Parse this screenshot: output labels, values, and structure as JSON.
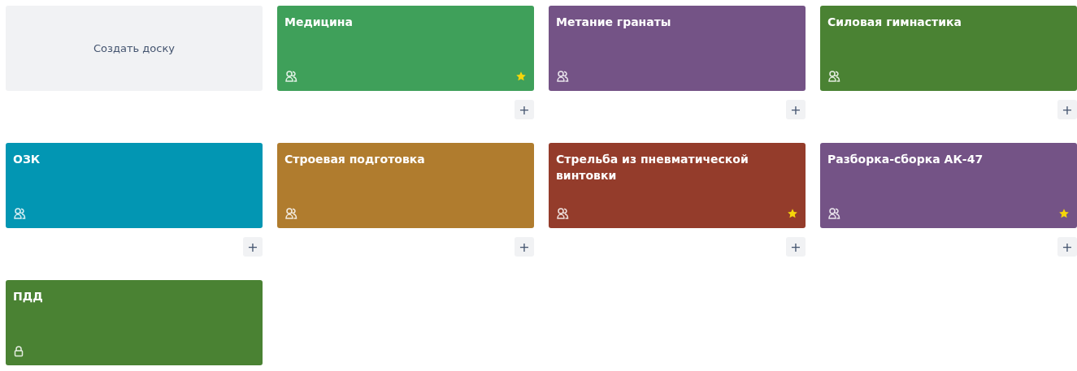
{
  "create_board": {
    "label": "Создать доску"
  },
  "boards": [
    {
      "title": "Медицина",
      "color": "#3fa05a",
      "kind": "team",
      "starred": true,
      "add": "+"
    },
    {
      "title": "Метание гранаты",
      "color": "#745386",
      "kind": "team",
      "starred": false,
      "add": "+"
    },
    {
      "title": "Силовая гимнастика",
      "color": "#4a8233",
      "kind": "team",
      "starred": false,
      "add": "+"
    },
    {
      "title": "ОЗК",
      "color": "#0296b3",
      "kind": "team",
      "starred": false,
      "add": "+"
    },
    {
      "title": "Строевая подготовка",
      "color": "#b07c2e",
      "kind": "team",
      "starred": false,
      "add": "+"
    },
    {
      "title": "Стрельба из пневматической винтовки",
      "color": "#943c2b",
      "kind": "team",
      "starred": true,
      "add": "+"
    },
    {
      "title": "Разборка-сборка АК-47",
      "color": "#745386",
      "kind": "team",
      "starred": true,
      "add": "+"
    },
    {
      "title": "ПДД",
      "color": "#4a8233",
      "kind": "private",
      "starred": false
    }
  ]
}
